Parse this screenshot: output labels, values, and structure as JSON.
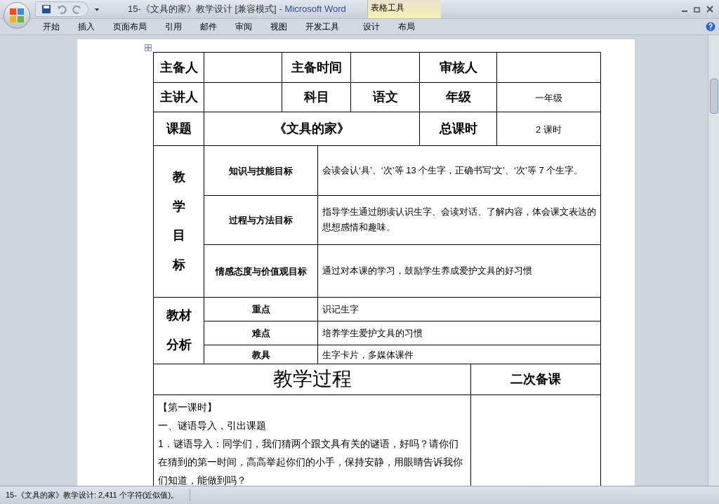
{
  "window": {
    "title": "15-《文具的家》教学设计 [兼容模式]",
    "app": "- Microsoft Word",
    "context_tab_group": "表格工具"
  },
  "ribbon_tabs": [
    {
      "label": "开始",
      "selected": false
    },
    {
      "label": "插入",
      "selected": false
    },
    {
      "label": "页面布局",
      "selected": false
    },
    {
      "label": "引用",
      "selected": false
    },
    {
      "label": "邮件",
      "selected": false
    },
    {
      "label": "审阅",
      "selected": false
    },
    {
      "label": "视图",
      "selected": false
    },
    {
      "label": "开发工具",
      "selected": false
    },
    {
      "label": "设计",
      "selected": false,
      "kind": "context"
    },
    {
      "label": "布局",
      "selected": false,
      "kind": "context"
    }
  ],
  "info_rows": [
    {
      "cells": [
        {
          "text": "主备人",
          "bold": true
        },
        {},
        {
          "text": "主备时间",
          "bold": true
        },
        {},
        {
          "text": "审核人",
          "bold": true
        },
        {}
      ]
    },
    {
      "cells": [
        {
          "text": "主讲人",
          "bold": true
        },
        {},
        {
          "text": "科目",
          "bold": true
        },
        {
          "text": "语文",
          "bold": true
        },
        {
          "text": "年级",
          "bold": true
        },
        {
          "text": "一年级",
          "bold": false
        }
      ]
    }
  ],
  "topic_row": {
    "label": "课题",
    "value": "《文具的家》",
    "hours_label": "总课时",
    "hours": "2 课时"
  },
  "goals": {
    "label": "教学目标",
    "rows": [
      {
        "name": "知识与技能目标",
        "text": "会读会认‘具’、‘次’等 13 个生字，正确书写‘文’、‘次’等 7 个生字。"
      },
      {
        "name": "过程与方法目标",
        "text": "指导学生通过朗读认识生字、会读对话、了解内容，体会课文表达的思想感情和趣味。"
      },
      {
        "name": "情感态度与价值观目标",
        "text": "通过对本课的学习，鼓励学生养成爱护文具的好习惯"
      }
    ]
  },
  "materials": {
    "label": "教材分析",
    "rows": [
      {
        "name": "重点",
        "text": "识记生字"
      },
      {
        "name": "难点",
        "text": "培养学生爱护文具的习惯"
      },
      {
        "name": "教具",
        "text": "生字卡片，多媒体课件"
      }
    ]
  },
  "process": {
    "heading": "教学过程",
    "side_heading": "二次备课",
    "lines": [
      "【第一课时】",
      "一、谜语导入，引出课题",
      "1．谜语导入：同学们，我们猜两个跟文具有关的谜语，好吗？请你们在猜到的第一时间，高高举起你们的小手，保持安静，用眼睛告诉我你们知道，能做到吗？"
    ]
  },
  "status_bar": "15-《文具的家》教学设计: 2,411 个字符(近似值)。"
}
